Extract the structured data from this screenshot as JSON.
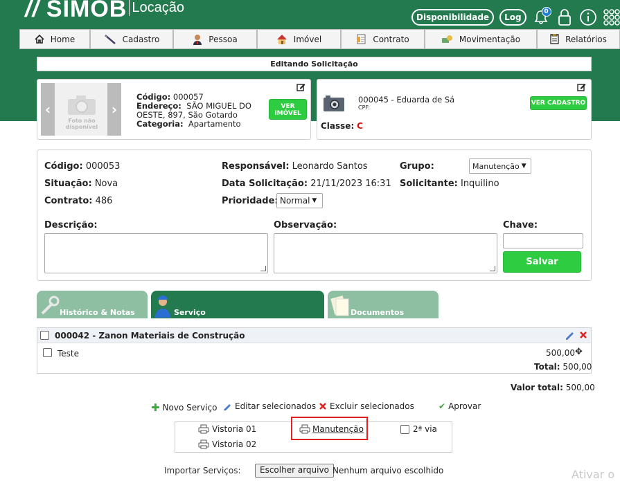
{
  "brand": {
    "name": "SIMOB",
    "sub": "Locação"
  },
  "top": {
    "disponibilidade": "Disponibilidade",
    "log": "Log",
    "notif_count": "0"
  },
  "nav": [
    {
      "label": "Home",
      "icon": "home-icon"
    },
    {
      "label": "Cadastro",
      "icon": "pen-icon"
    },
    {
      "label": "Pessoa",
      "icon": "person-icon"
    },
    {
      "label": "Imóvel",
      "icon": "house-icon"
    },
    {
      "label": "Contrato",
      "icon": "contract-icon"
    },
    {
      "label": "Movimentação",
      "icon": "money-icon"
    },
    {
      "label": "Relatórios",
      "icon": "report-icon"
    }
  ],
  "page_title": "Editando Solicitação",
  "imovel": {
    "codigo_label": "Código:",
    "codigo": "000057",
    "endereco_label": "Endereço:",
    "endereco_1": "SÃO MIGUEL DO",
    "endereco_2": "OESTE, 897, São Gotardo",
    "categoria_label": "Categoria:",
    "categoria": "Apartamento",
    "photo_text_1": "Foto não",
    "photo_text_2": "disponível",
    "button_1": "VER",
    "button_2": "IMÓVEL"
  },
  "pessoa": {
    "name": "000045 - Eduarda de Sá",
    "cpf": "CPF:",
    "classe_label": "Classe:",
    "classe": "C",
    "button": "VER CADASTRO"
  },
  "details": {
    "codigo_label": "Código:",
    "codigo": "000053",
    "situacao_label": "Situação:",
    "situacao": "Nova",
    "contrato_label": "Contrato:",
    "contrato": "486",
    "responsavel_label": "Responsável:",
    "responsavel": "Leonardo Santos",
    "data_label": "Data Solicitação:",
    "data": "21/11/2023 16:31",
    "prioridade_label": "Prioridade:",
    "prioridade": "Normal",
    "grupo_label": "Grupo:",
    "grupo": "Manutenção",
    "solicitante_label": "Solicitante:",
    "solicitante": "Inquilino",
    "descricao_label": "Descrição:",
    "observacao_label": "Observação:",
    "chave_label": "Chave:",
    "salvar": "Salvar"
  },
  "tabs": [
    {
      "label": "Histórico & Notas"
    },
    {
      "label": "Serviço"
    },
    {
      "label": "Documentos"
    }
  ],
  "service": {
    "title": "000042 - Zanon Materiais de Construção",
    "item": "Teste",
    "item_value": "500,00",
    "total_label": "Total:",
    "total": "500,00",
    "valor_total_label": "Valor total:",
    "valor_total": "500,00"
  },
  "actions": {
    "novo": "Novo Serviço",
    "editar": "Editar selecionados",
    "excluir": "Excluir selecionados",
    "aprovar": "Aprovar"
  },
  "prints": {
    "vistoria1": "Vistoria 01",
    "vistoria2": "Vistoria 02",
    "manutencao": "Manutenção",
    "segunda_via": "2ª via"
  },
  "import": {
    "label": "Importar Serviços:",
    "button": "Escolher arquivo",
    "status": "Nenhum arquivo escolhido"
  },
  "watermark": "Ativar o",
  "colors": {
    "brand_green": "#247a4f",
    "button_green": "#2ecc40",
    "tab_active": "#247a4f",
    "tab_inactive": "#8fbfa3",
    "highlight": "#e02020",
    "danger": "#e02020"
  }
}
